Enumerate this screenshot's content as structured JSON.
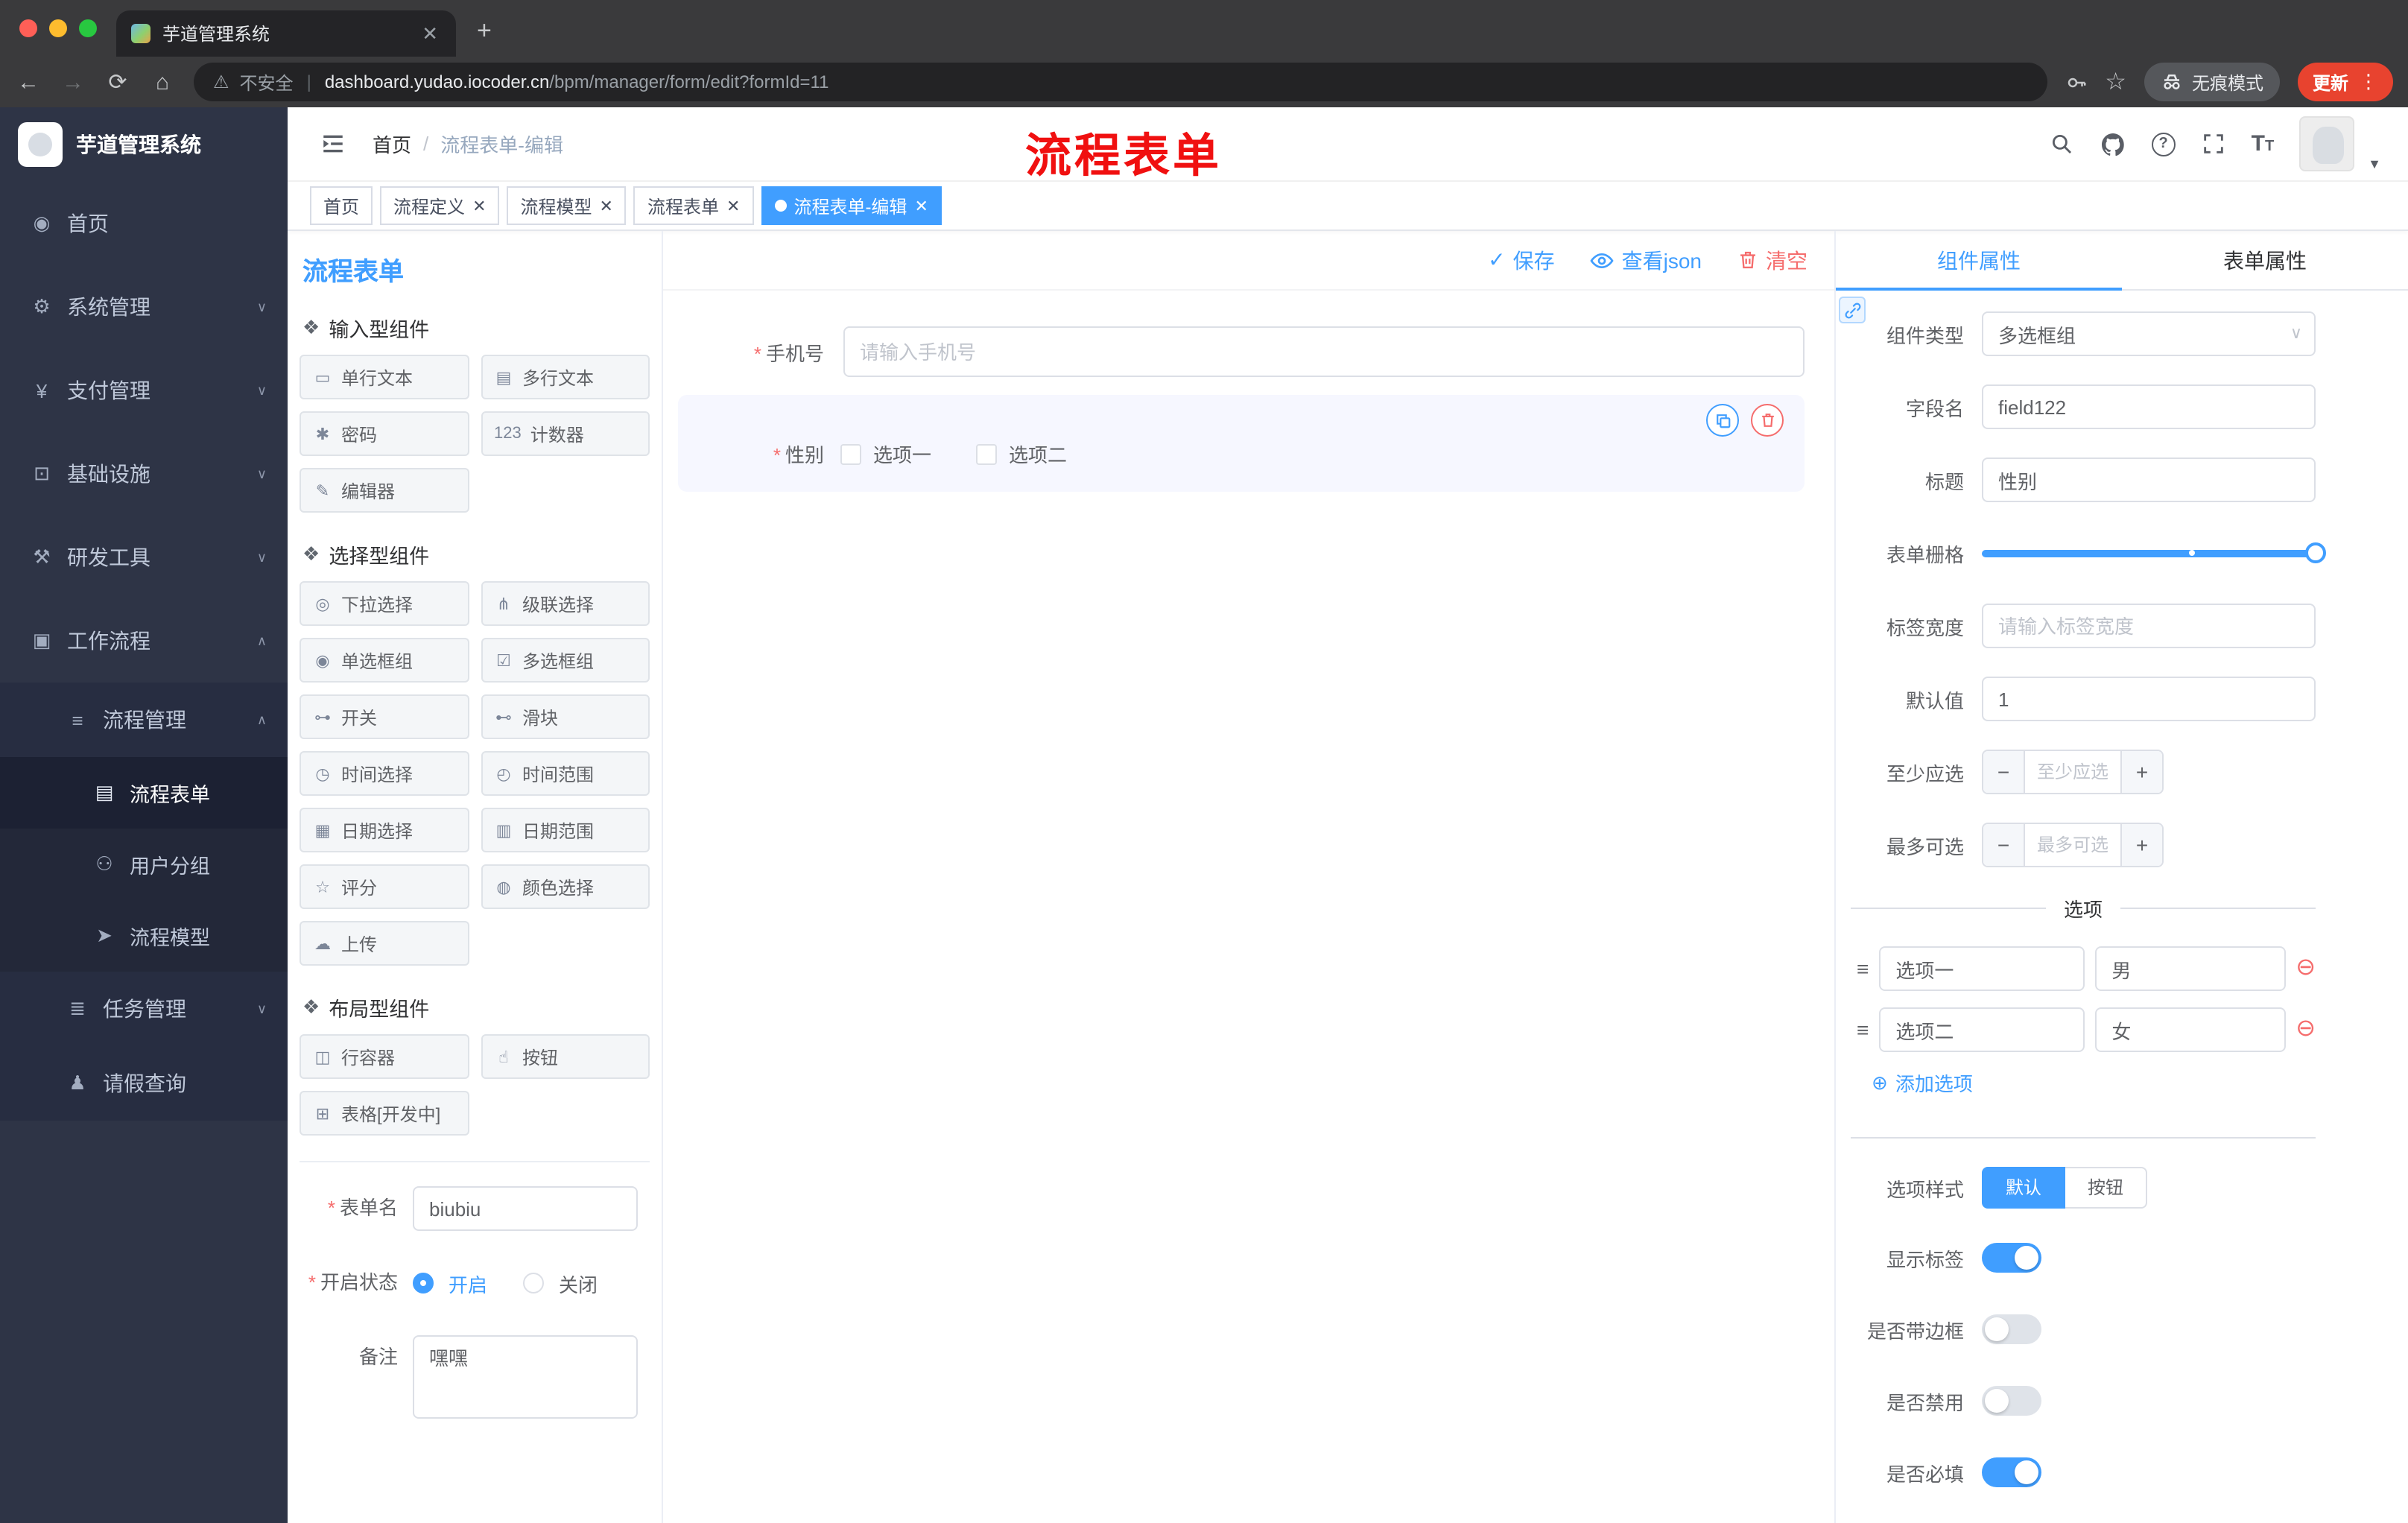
{
  "colors": {
    "primary": "#409eff",
    "danger": "#f56c6c",
    "annotation_red": "#f01010",
    "sidebar_bg": "#2e3446"
  },
  "browser": {
    "tab_title": "芋道管理系统",
    "security_label": "不安全",
    "url_domain": "dashboard.yudao.iocoder.cn",
    "url_path": "/bpm/manager/form/edit?formId=11",
    "incognito_label": "无痕模式",
    "update_label": "更新"
  },
  "sidebar": {
    "app_title": "芋道管理系统",
    "items": [
      {
        "label": "首页",
        "icon": "dashboard-icon"
      },
      {
        "label": "系统管理",
        "icon": "gear-icon"
      },
      {
        "label": "支付管理",
        "icon": "yen-icon"
      },
      {
        "label": "基础设施",
        "icon": "monitor-icon"
      },
      {
        "label": "研发工具",
        "icon": "tools-icon"
      },
      {
        "label": "工作流程",
        "icon": "workflow-icon"
      }
    ],
    "workflow_children": {
      "process_manage": {
        "label": "流程管理",
        "icon": "menu-list-icon"
      },
      "process_children": [
        {
          "label": "流程表单",
          "icon": "form-icon"
        },
        {
          "label": "用户分组",
          "icon": "group-icon"
        },
        {
          "label": "流程模型",
          "icon": "model-icon"
        }
      ],
      "task_manage": {
        "label": "任务管理",
        "icon": "task-icon"
      },
      "leave_query": {
        "label": "请假查询",
        "icon": "person-icon"
      }
    }
  },
  "header": {
    "breadcrumb": [
      "首页",
      "流程表单-编辑"
    ],
    "annotation": "流程表单"
  },
  "tags": [
    {
      "label": "首页"
    },
    {
      "label": "流程定义"
    },
    {
      "label": "流程模型"
    },
    {
      "label": "流程表单"
    },
    {
      "label": "流程表单-编辑"
    }
  ],
  "editor": {
    "panel_title": "流程表单",
    "actions": {
      "save": "保存",
      "view_json": "查看json",
      "clear": "清空"
    },
    "palette": {
      "sections": [
        {
          "title": "输入型组件",
          "items": [
            {
              "label": "单行文本",
              "icon": "input-icon"
            },
            {
              "label": "多行文本",
              "icon": "textarea-icon"
            },
            {
              "label": "密码",
              "icon": "password-icon"
            },
            {
              "label": "计数器",
              "icon": "counter-icon"
            },
            {
              "label": "编辑器",
              "icon": "editor-icon"
            }
          ]
        },
        {
          "title": "选择型组件",
          "items": [
            {
              "label": "下拉选择",
              "icon": "select-icon"
            },
            {
              "label": "级联选择",
              "icon": "cascader-icon"
            },
            {
              "label": "单选框组",
              "icon": "radio-icon"
            },
            {
              "label": "多选框组",
              "icon": "checkbox-icon"
            },
            {
              "label": "开关",
              "icon": "switch-icon"
            },
            {
              "label": "滑块",
              "icon": "slider-icon"
            },
            {
              "label": "时间选择",
              "icon": "time-icon"
            },
            {
              "label": "时间范围",
              "icon": "time-range-icon"
            },
            {
              "label": "日期选择",
              "icon": "date-icon"
            },
            {
              "label": "日期范围",
              "icon": "date-range-icon"
            },
            {
              "label": "评分",
              "icon": "rate-icon"
            },
            {
              "label": "颜色选择",
              "icon": "color-icon"
            },
            {
              "label": "上传",
              "icon": "upload-icon"
            }
          ]
        },
        {
          "title": "布局型组件",
          "items": [
            {
              "label": "行容器",
              "icon": "row-icon"
            },
            {
              "label": "按钮",
              "icon": "button-icon"
            },
            {
              "label": "表格[开发中]",
              "icon": "table-icon"
            }
          ]
        }
      ]
    },
    "form_meta": {
      "name_label": "表单名",
      "name_value": "biubiu",
      "status_label": "开启状态",
      "status_on": "开启",
      "status_off": "关闭",
      "remark_label": "备注",
      "remark_value": "嘿嘿"
    },
    "canvas": {
      "phone_label": "手机号",
      "phone_placeholder": "请输入手机号",
      "gender_label": "性别",
      "gender_options": [
        "选项一",
        "选项二"
      ]
    },
    "props": {
      "tabs": [
        "组件属性",
        "表单属性"
      ],
      "rows": {
        "component_type": {
          "label": "组件类型",
          "value": "多选框组"
        },
        "field_name": {
          "label": "字段名",
          "value": "field122"
        },
        "title": {
          "label": "标题",
          "value": "性别"
        },
        "grid": {
          "label": "表单栅格"
        },
        "label_width": {
          "label": "标签宽度",
          "placeholder": "请输入标签宽度"
        },
        "default_value": {
          "label": "默认值",
          "value": "1"
        },
        "min_select": {
          "label": "至少应选",
          "placeholder": "至少应选"
        },
        "max_select": {
          "label": "最多可选",
          "placeholder": "最多可选"
        }
      },
      "options_divider": "选项",
      "options": [
        {
          "label": "选项一",
          "value": "男"
        },
        {
          "label": "选项二",
          "value": "女"
        }
      ],
      "add_option": "添加选项",
      "option_style": {
        "label": "选项样式",
        "choices": [
          "默认",
          "按钮"
        ],
        "active": "默认"
      },
      "switches": [
        {
          "label": "显示标签",
          "on": true
        },
        {
          "label": "是否带边框",
          "on": false
        },
        {
          "label": "是否禁用",
          "on": false
        },
        {
          "label": "是否必填",
          "on": true
        }
      ]
    }
  }
}
